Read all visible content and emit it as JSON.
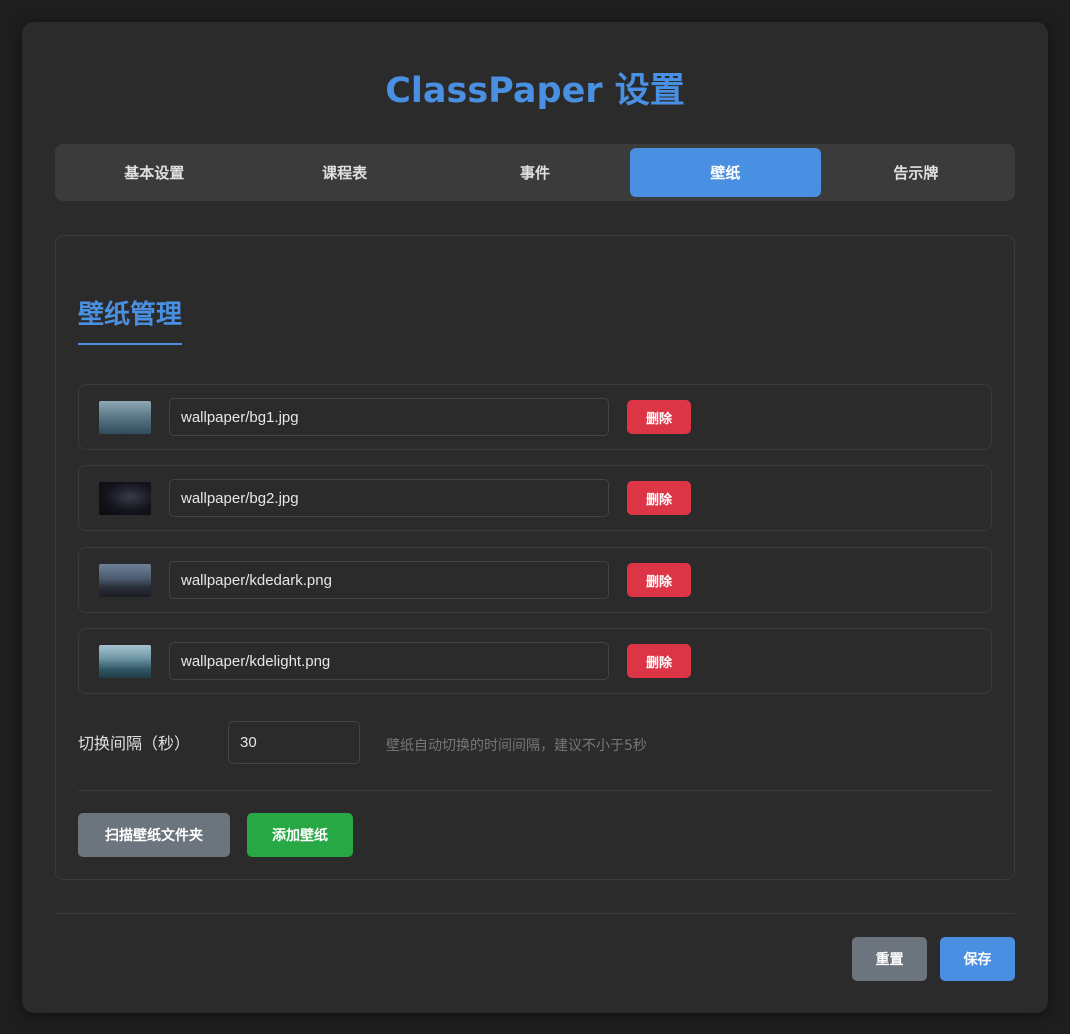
{
  "app": {
    "title": "ClassPaper 设置"
  },
  "tabs": [
    {
      "label": "基本设置",
      "active": false
    },
    {
      "label": "课程表",
      "active": false
    },
    {
      "label": "事件",
      "active": false
    },
    {
      "label": "壁纸",
      "active": true
    },
    {
      "label": "告示牌",
      "active": false
    }
  ],
  "wallpaper": {
    "section_title": "壁纸管理",
    "items": [
      {
        "path": "wallpaper/bg1.jpg",
        "thumbnail": "misty-forest-thumbnail",
        "delete_label": "删除"
      },
      {
        "path": "wallpaper/bg2.jpg",
        "thumbnail": "night-sky-thumbnail",
        "delete_label": "删除"
      },
      {
        "path": "wallpaper/kdedark.png",
        "thumbnail": "dark-mountain-thumbnail",
        "delete_label": "删除"
      },
      {
        "path": "wallpaper/kdelight.png",
        "thumbnail": "light-mountain-thumbnail",
        "delete_label": "删除"
      }
    ],
    "interval_label": "切换间隔（秒）",
    "interval_value": "30",
    "interval_hint": "壁纸自动切换的时间间隔，建议不小于5秒",
    "scan_button": "扫描壁纸文件夹",
    "add_button": "添加壁纸"
  },
  "footer": {
    "reset_button": "重置",
    "save_button": "保存"
  },
  "colors": {
    "accent": "#4a90e2",
    "danger": "#dc3545",
    "success": "#28a745",
    "secondary": "#6c757d",
    "background": "#2b2b2b"
  }
}
